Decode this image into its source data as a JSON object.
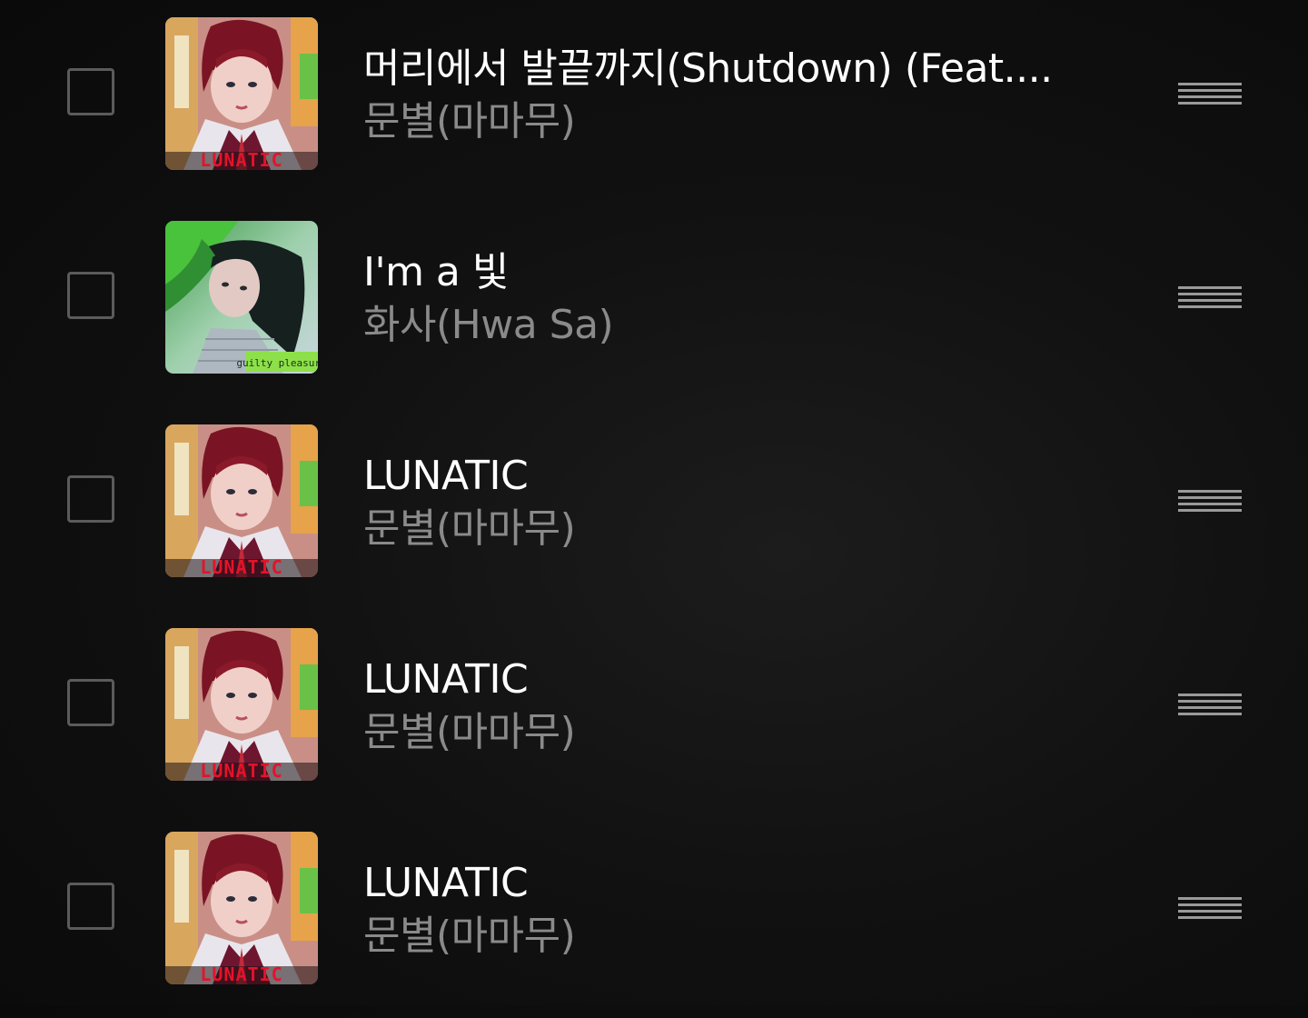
{
  "playlist": {
    "tracks": [
      {
        "title": "머리에서 발끝까지(Shutdown) (Feat....",
        "artist": "문별(마마무)",
        "album_art": "lunatic-cover"
      },
      {
        "title": "I'm a 빛",
        "artist": "화사(Hwa Sa)",
        "album_art": "guilty-pleasure-cover"
      },
      {
        "title": "LUNATIC",
        "artist": "문별(마마무)",
        "album_art": "lunatic-cover"
      },
      {
        "title": "LUNATIC",
        "artist": "문별(마마무)",
        "album_art": "lunatic-cover"
      },
      {
        "title": "LUNATIC",
        "artist": "문별(마마무)",
        "album_art": "lunatic-cover"
      }
    ]
  },
  "album_covers": {
    "lunatic": {
      "logo_text": "LUNATIC",
      "accent_color": "#e3132a"
    },
    "guilty_pleasure": {
      "logo_text": "guilty pleasure",
      "accent_color": "#8ee04a"
    }
  },
  "colors": {
    "background": "#0f0f0f",
    "title_text": "#ffffff",
    "artist_text": "#8a8a8a",
    "checkbox_border": "#5b5b5b",
    "drag_handle": "#9a9a9a"
  },
  "icons": {
    "checkbox": "checkbox-icon",
    "drag_handle": "drag-handle-icon"
  }
}
